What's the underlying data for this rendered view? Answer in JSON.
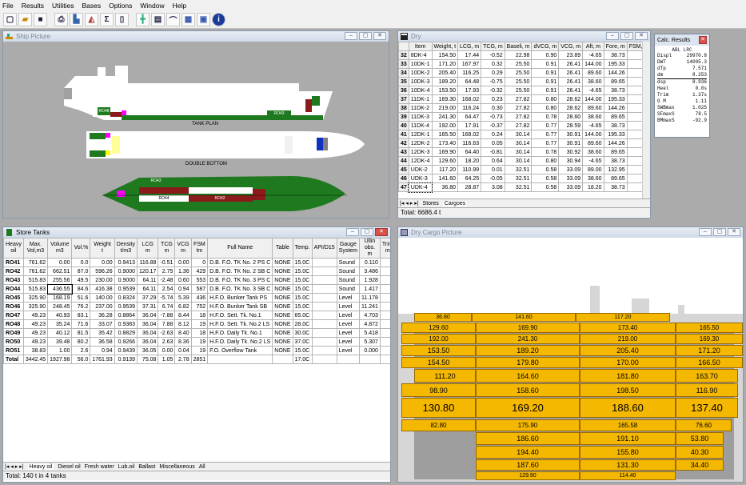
{
  "menu": [
    "File",
    "Results",
    "Utilities",
    "Bases",
    "Options",
    "Window",
    "Help"
  ],
  "toolbar_icons": [
    "new-icon",
    "open-icon",
    "save-icon",
    "print-icon",
    "weights-icon",
    "tanks-icon",
    "sigma-icon",
    "bracket-icon",
    "stability-icon",
    "strength-icon",
    "curve-icon",
    "calculator-icon",
    "window-icon",
    "info-icon"
  ],
  "ship_picture": {
    "title": "Ship Picture",
    "tank_plan_label": "TANK PLAN",
    "double_bottom_label": "DOUBLE BOTTOM"
  },
  "dry": {
    "title": "Dry",
    "headers": [
      "Item",
      "Weight, t",
      "LCG, m",
      "TCG, m",
      "Baseli, m",
      "dVCG, m",
      "VCG, m",
      "Aft, m",
      "Fore, m",
      "FSM, tm"
    ],
    "rows": [
      [
        "32",
        "8DK-4",
        "154.50",
        "17.44",
        "-0.52",
        "22.98",
        "0.90",
        "23.89",
        "-4.65",
        "38.73",
        "0"
      ],
      [
        "33",
        "10DK-1",
        "171.20",
        "167.97",
        "0.32",
        "25.50",
        "0.91",
        "26.41",
        "144.00",
        "195.33",
        "0"
      ],
      [
        "34",
        "10DK-2",
        "205.40",
        "116.25",
        "0.29",
        "25.50",
        "0.91",
        "26.41",
        "89.60",
        "144.26",
        "0"
      ],
      [
        "35",
        "10DK-3",
        "189.20",
        "64.48",
        "-0.75",
        "25.50",
        "0.91",
        "26.41",
        "38.60",
        "89.65",
        "0"
      ],
      [
        "36",
        "10DK-4",
        "153.50",
        "17.93",
        "-0.32",
        "25.50",
        "0.91",
        "26.41",
        "-4.65",
        "38.73",
        "0"
      ],
      [
        "37",
        "11DK-1",
        "169.30",
        "168.02",
        "0.23",
        "27.82",
        "0.80",
        "28.62",
        "144.00",
        "195.33",
        "0"
      ],
      [
        "38",
        "11DK-2",
        "219.00",
        "116.24",
        "0.30",
        "27.82",
        "0.80",
        "28.62",
        "89.60",
        "144.26",
        "0"
      ],
      [
        "39",
        "11DK-3",
        "241.30",
        "64.47",
        "-0.73",
        "27.82",
        "0.78",
        "28.60",
        "38.60",
        "89.65",
        "0"
      ],
      [
        "40",
        "11DK-4",
        "192.00",
        "17.91",
        "-0.37",
        "27.82",
        "0.77",
        "28.59",
        "-4.65",
        "38.73",
        "0"
      ],
      [
        "41",
        "12DK-1",
        "165.50",
        "168.02",
        "0.24",
        "30.14",
        "0.77",
        "30.91",
        "144.00",
        "195.33",
        "0"
      ],
      [
        "42",
        "12DK-2",
        "173.40",
        "116.63",
        "0.05",
        "30.14",
        "0.77",
        "30.91",
        "89.60",
        "144.26",
        "0"
      ],
      [
        "43",
        "12DK-3",
        "169.90",
        "64.40",
        "-0.81",
        "30.14",
        "0.78",
        "30.92",
        "38.60",
        "89.65",
        "0"
      ],
      [
        "44",
        "12DK-4",
        "129.60",
        "18.20",
        "0.64",
        "30.14",
        "0.80",
        "30.94",
        "-4.65",
        "38.73",
        "0"
      ],
      [
        "45",
        "UDK-2",
        "117.20",
        "110.99",
        "0.01",
        "32.51",
        "0.58",
        "33.09",
        "89.00",
        "132.95",
        "0"
      ],
      [
        "46",
        "UDK-3",
        "141.60",
        "64.25",
        "-0.05",
        "32.51",
        "0.58",
        "33.09",
        "38.60",
        "89.65",
        "0"
      ],
      [
        "47",
        "UDK-4",
        "36.80",
        "28.87",
        "3.08",
        "32.51",
        "0.58",
        "33.09",
        "18.20",
        "38.73",
        "0"
      ]
    ],
    "tabs": [
      "Stores",
      "Cargoes"
    ],
    "status": "Total: 6686.4 t"
  },
  "calc": {
    "title": "Calc. Results",
    "sub": "ABL LRC",
    "rows": [
      [
        "Displ",
        "29970.8"
      ],
      [
        "DWT",
        "14005.3"
      ],
      [
        "dTp",
        "7.571"
      ],
      [
        "dm",
        "8.253"
      ],
      [
        "dsp",
        "8.936"
      ],
      [
        "Heel",
        "0.0s"
      ],
      [
        "Trim",
        "1.37s"
      ],
      [
        "G M",
        "1.11"
      ],
      [
        "SWBmax",
        "1.025"
      ],
      [
        "SFmaxS",
        "78.5"
      ],
      [
        "BMmaxS",
        "-92.9"
      ]
    ]
  },
  "store": {
    "title": "Store Tanks",
    "headers": [
      "Heavy oil",
      "Max. Vol,m3",
      "Volume m3",
      "Vol.%",
      "Weight t",
      "Density t/m3",
      "LCG m",
      "TCG m",
      "VCG m",
      "FSM tm",
      "Full Name",
      "Table",
      "Temp.",
      "API/D15",
      "Gauge System",
      "Ullin obs. m",
      "Trim m",
      "Heel deg",
      "Ul co"
    ],
    "rows": [
      [
        "RO41",
        "761.62",
        "0.00",
        "0.0",
        "0.00",
        "0.9413",
        "116.88",
        "-0.51",
        "0.00",
        "0",
        "D.B. F.O. TK No. 2 PS C",
        "NONE",
        "15.0C",
        "",
        "Sound",
        "0.110",
        "",
        "",
        ""
      ],
      [
        "RO42",
        "761.62",
        "662.51",
        "87.0",
        "596.26",
        "0.9000",
        "120.17",
        "2.75",
        "1.36",
        "429",
        "D.B. F.O. TK No. 2 SB C",
        "NONE",
        "15.0C",
        "",
        "Sound",
        "3.486",
        "",
        "",
        ""
      ],
      [
        "RO43",
        "515.83",
        "255.56",
        "49.5",
        "230.00",
        "0.9000",
        "64.11",
        "-2.48",
        "0.60",
        "553",
        "D.B. F.O. TK No. 3 PS C",
        "NONE",
        "15.0C",
        "",
        "Sound",
        "1.928",
        "",
        "",
        ""
      ],
      [
        "RO44",
        "515.83",
        "436.55",
        "84.6",
        "416.38",
        "0.9539",
        "64.11",
        "2.54",
        "0.94",
        "587",
        "D.B. F.O. TK No. 3 SB C",
        "NONE",
        "15.0C",
        "",
        "Sound",
        "1.417",
        "",
        "",
        ""
      ],
      [
        "RO45",
        "325.90",
        "168.19",
        "51.6",
        "140.00",
        "0.8324",
        "37.29",
        "-5.74",
        "5.39",
        "436",
        "H.F.O. Bunker Tank PS",
        "NONE",
        "15.0C",
        "",
        "Level",
        "11.178",
        "",
        "",
        ""
      ],
      [
        "RO46",
        "325.90",
        "248.45",
        "76.2",
        "237.00",
        "0.9539",
        "37.31",
        "6.74",
        "6.82",
        "752",
        "H.F.O. Bunker Tank SB",
        "NONE",
        "15.0C",
        "",
        "Level",
        "11.241",
        "",
        "",
        ""
      ],
      [
        "RO47",
        "49.23",
        "40.93",
        "83.1",
        "36.28",
        "0.8864",
        "36.04",
        "-7.88",
        "8.44",
        "18",
        "H.F.O. Sett. Tk. No.1",
        "NONE",
        "65.0C",
        "",
        "Level",
        "4.703",
        "",
        "",
        ""
      ],
      [
        "RO48",
        "49.23",
        "35.24",
        "71.6",
        "33.07",
        "0.9383",
        "36.04",
        "7.88",
        "8.12",
        "19",
        "H.F.O. Sett. Tk. No.2 LS",
        "NONE",
        "28.0C",
        "",
        "Level",
        "4.872",
        "",
        "",
        ""
      ],
      [
        "RO49",
        "49.23",
        "40.12",
        "81.5",
        "35.42",
        "0.8829",
        "36.04",
        "-2.63",
        "8.40",
        "18",
        "H.F.O. Daily Tk. No.1",
        "NONE",
        "30.0C",
        "",
        "Level",
        "5.418",
        "",
        "",
        ""
      ],
      [
        "RO50",
        "49.23",
        "39.48",
        "80.2",
        "36.58",
        "0.9266",
        "36.04",
        "2.63",
        "8.36",
        "19",
        "H.F.O. Daily Tk. No.2 LS",
        "NONE",
        "37.0C",
        "",
        "Level",
        "5.307",
        "",
        "",
        ""
      ],
      [
        "RO51",
        "38.83",
        "1.00",
        "2.6",
        "0.94",
        "0.9439",
        "36.05",
        "0.00",
        "0.04",
        "19",
        "F.O. Overflow Tank",
        "NONE",
        "15.0C",
        "",
        "Level",
        "0.000",
        "",
        "",
        ""
      ],
      [
        "Total",
        "3442.45",
        "1927.98",
        "56.0",
        "1761.93",
        "0.9139",
        "75.08",
        "1.05",
        "2.78",
        "2851",
        "",
        "",
        "17.0C",
        "",
        "",
        "",
        "",
        "",
        ""
      ]
    ],
    "tabs": [
      "Heavy oil",
      "Diesel oil",
      "Fresh water",
      "Lub.oil",
      "Ballast",
      "Miscellaneous",
      "All"
    ],
    "status": "Total: 140 t in 4 tanks"
  },
  "cargo_picture": {
    "title": "Dry Cargo Picture",
    "rows": [
      [
        "36.80",
        "141.60",
        "117.20"
      ],
      [
        "129.60",
        "169.90",
        "173.40",
        "165.50"
      ],
      [
        "192.00",
        "241.30",
        "219.00",
        "169.30"
      ],
      [
        "153.50",
        "189.20",
        "205.40",
        "171.20"
      ],
      [
        "154.50",
        "179.80",
        "170.00",
        "166.50"
      ],
      [
        "111.20",
        "164.60",
        "181.80",
        "163.70"
      ],
      [
        "98.90",
        "158.60",
        "198.50",
        "116.90"
      ],
      [
        "130.80",
        "169.20",
        "188.60",
        "137.40"
      ],
      [
        "82.80",
        "175.90",
        "165.58",
        "76.60"
      ],
      [
        "186.60",
        "191.10",
        "53.80"
      ],
      [
        "194.40",
        "155.80",
        "40.30"
      ],
      [
        "187.60",
        "131.30",
        "34.40"
      ],
      [
        "129.90",
        "114.40"
      ]
    ]
  },
  "tank_labels": {
    "profile": [
      "RO48",
      "RO47",
      "RO45",
      "RO46",
      "RO43",
      "RO44",
      "RO41",
      "RO42"
    ],
    "db": [
      "RO43",
      "RO41",
      "RO45",
      "RO44",
      "RO42",
      "RO46"
    ]
  }
}
